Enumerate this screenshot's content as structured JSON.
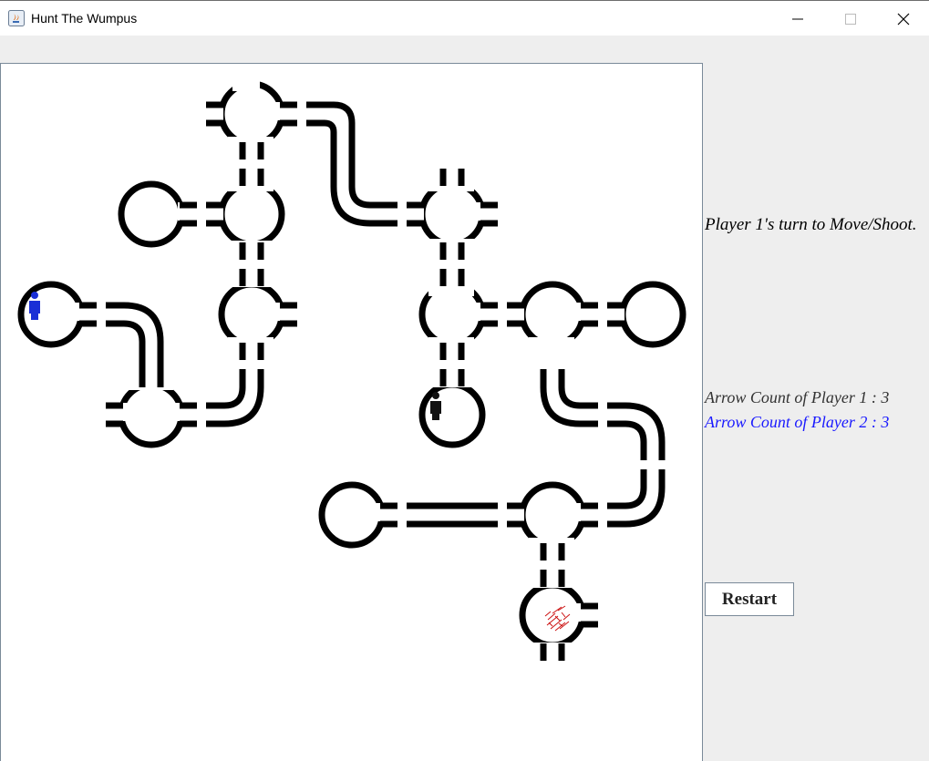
{
  "window": {
    "title": "Hunt The Wumpus"
  },
  "status": {
    "turn_message": "Player 1's turn to Move/Shoot.",
    "arrow_count_player1": "Arrow Count of Player 1 : 3",
    "arrow_count_player2": "Arrow Count of Player 2 : 3"
  },
  "controls": {
    "restart_label": "Restart"
  },
  "colors": {
    "player1": "#1a2fd6",
    "player2": "#111111",
    "hazard": "#cc1111",
    "player2_text": "#1a1aff"
  },
  "icons": [
    "java-app-icon",
    "minimize-icon",
    "maximize-icon",
    "close-icon",
    "player-1-icon",
    "player-2-icon",
    "blood-hazard-icon"
  ]
}
